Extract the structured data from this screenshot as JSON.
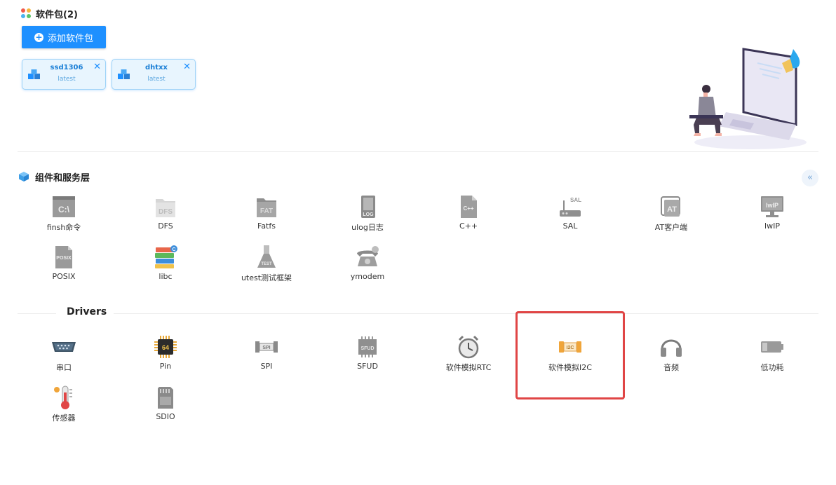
{
  "packages": {
    "title": "软件包(2)",
    "add_button": "添加软件包",
    "items": [
      {
        "name": "ssd1306",
        "version": "latest"
      },
      {
        "name": "dhtxx",
        "version": "latest"
      }
    ]
  },
  "components": {
    "title": "组件和服务层",
    "collapse_icon": "double-chevron-left-icon",
    "items": [
      {
        "label": "finsh命令",
        "icon": "cmd-terminal-icon"
      },
      {
        "label": "DFS",
        "icon": "dfs-folder-icon"
      },
      {
        "label": "Fatfs",
        "icon": "fat-folder-icon"
      },
      {
        "label": "ulog日志",
        "icon": "log-file-icon"
      },
      {
        "label": "C++",
        "icon": "cpp-file-icon"
      },
      {
        "label": "SAL",
        "icon": "router-icon"
      },
      {
        "label": "AT客户端",
        "icon": "at-client-icon"
      },
      {
        "label": "lwIP",
        "icon": "monitor-icon"
      },
      {
        "label": "POSIX",
        "icon": "posix-file-icon"
      },
      {
        "label": "libc",
        "icon": "books-icon"
      },
      {
        "label": "utest测试框架",
        "icon": "test-flask-icon"
      },
      {
        "label": "ymodem",
        "icon": "telephone-icon"
      }
    ]
  },
  "drivers": {
    "title": "Drivers",
    "items": [
      {
        "label": "串口",
        "icon": "serial-port-icon"
      },
      {
        "label": "Pin",
        "icon": "chip-icon"
      },
      {
        "label": "SPI",
        "icon": "spi-bus-icon"
      },
      {
        "label": "SFUD",
        "icon": "sfud-chip-icon"
      },
      {
        "label": "软件模拟RTC",
        "icon": "alarm-clock-icon"
      },
      {
        "label": "软件模拟I2C",
        "icon": "i2c-bus-icon"
      },
      {
        "label": "音频",
        "icon": "headphones-icon"
      },
      {
        "label": "低功耗",
        "icon": "battery-icon"
      },
      {
        "label": "传感器",
        "icon": "thermometer-icon"
      },
      {
        "label": "SDIO",
        "icon": "sd-card-icon"
      }
    ]
  },
  "icon_text": {
    "cmd": "C:\\",
    "dfs": "DFS",
    "fat": "FAT",
    "log": "LOG",
    "cpp": "C++",
    "sal": "SAL",
    "at": "AT",
    "lwip": "lwIP",
    "posix": "POSIX",
    "test": "TEST",
    "chip": "64",
    "spi": "SPI",
    "sfud": "SFUD",
    "i2c": "I2C",
    "libc_badge": "C"
  },
  "colors": {
    "primary": "#1e90ff",
    "highlight": "#e04545",
    "card_bg": "#e8f5fe"
  }
}
